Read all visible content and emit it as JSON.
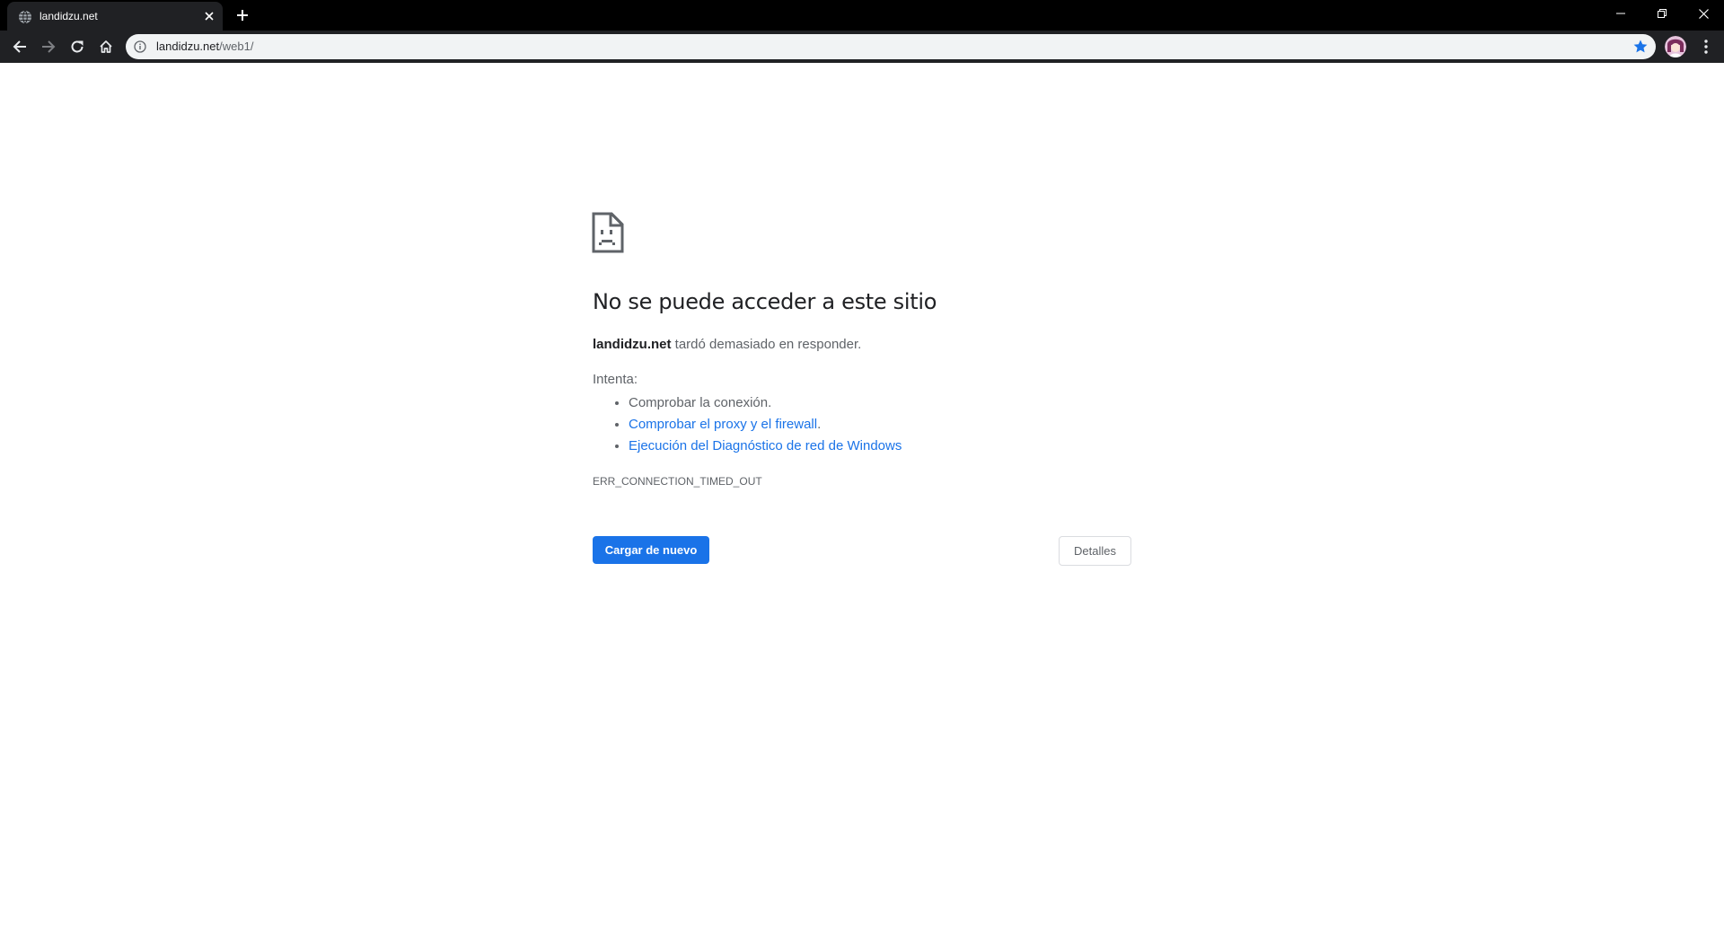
{
  "browser": {
    "tab": {
      "title": "landidzu.net",
      "favicon": "globe-icon"
    },
    "new_tab_icon": "plus-icon",
    "window_controls": [
      "minimize-icon",
      "restore-icon",
      "close-icon"
    ],
    "nav": [
      "back-arrow-icon",
      "forward-arrow-icon",
      "reload-icon",
      "home-icon"
    ],
    "omnibox": {
      "security_icon": "info-icon",
      "host": "landidzu.net",
      "path": "/web1/",
      "bookmark_starred": true,
      "star_color": "#8ab4f8"
    },
    "theme": {
      "tabstrip_bg": "#000000",
      "toolbar_bg": "#202124",
      "omnibox_bg": "#f1f3f4"
    }
  },
  "error_page": {
    "icon": "sad-page-icon",
    "title": "No se puede acceder a este sitio",
    "description": {
      "host": "landidzu.net",
      "text": " tardó demasiado en responder."
    },
    "suggestions_heading": "Intenta:",
    "suggestions": [
      {
        "text": "Comprobar la conexión.",
        "link": false
      },
      {
        "text": "Comprobar el proxy y el firewall",
        "suffix": ".",
        "link": true
      },
      {
        "text": "Ejecución del Diagnóstico de red de Windows",
        "link": true
      }
    ],
    "error_code": "ERR_CONNECTION_TIMED_OUT",
    "buttons": {
      "reload": "Cargar de nuevo",
      "details": "Detalles"
    },
    "accent_color": "#1a73e8",
    "link_color": "#1a73e8"
  }
}
